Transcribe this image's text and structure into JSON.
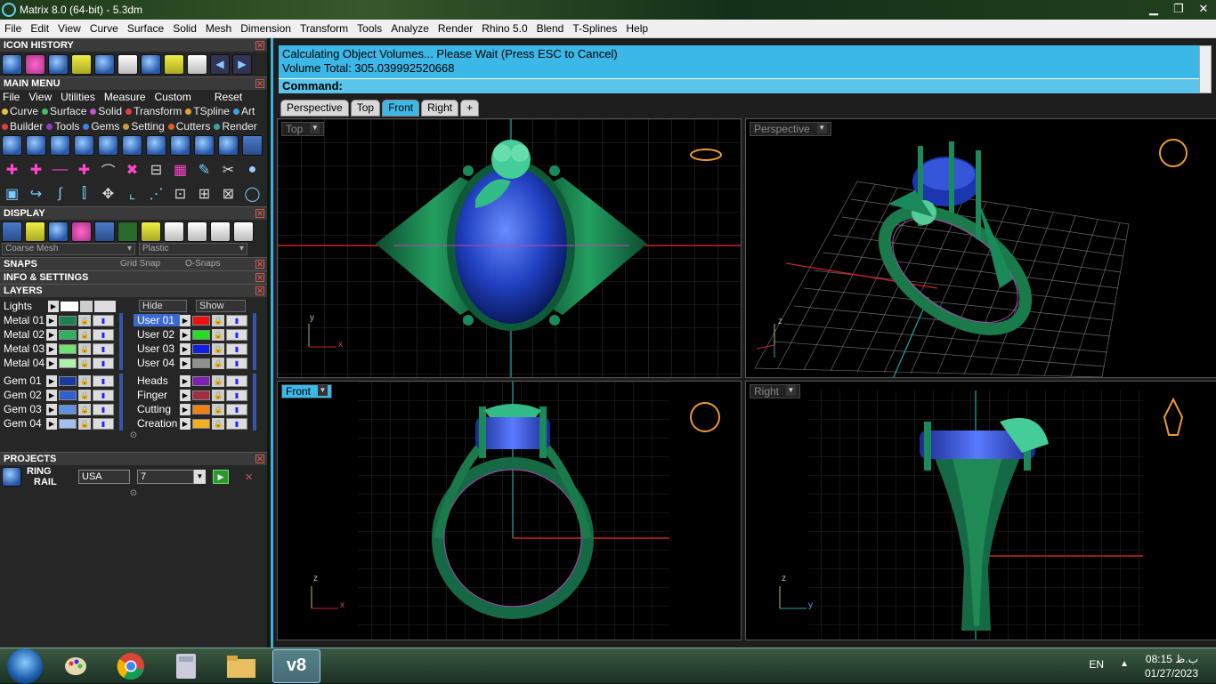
{
  "window": {
    "title": "Matrix 8.0 (64-bit) - 5.3dm"
  },
  "menu": [
    "File",
    "Edit",
    "View",
    "Curve",
    "Surface",
    "Solid",
    "Mesh",
    "Dimension",
    "Transform",
    "Tools",
    "Analyze",
    "Render",
    "Rhino 5.0",
    "Blend",
    "T-Splines",
    "Help"
  ],
  "left": {
    "icon_history": "ICON HISTORY",
    "main_menu": "MAIN MENU",
    "mm_sub": [
      "File",
      "View",
      "Utilities",
      "Measure",
      "Custom",
      "Reset"
    ],
    "cat_row1": [
      {
        "label": "Curve",
        "color": "#e8c040"
      },
      {
        "label": "Surface",
        "color": "#40c060"
      },
      {
        "label": "Solid",
        "color": "#c050d0"
      },
      {
        "label": "Transform",
        "color": "#e04040"
      },
      {
        "label": "TSpline",
        "color": "#e0a030"
      },
      {
        "label": "Art",
        "color": "#40a0e0"
      }
    ],
    "cat_row2": [
      {
        "label": "Builder",
        "color": "#e04040"
      },
      {
        "label": "Tools",
        "color": "#9040c0"
      },
      {
        "label": "Gems",
        "color": "#4080e0"
      },
      {
        "label": "Setting",
        "color": "#c0a040"
      },
      {
        "label": "Cutters",
        "color": "#e06020"
      },
      {
        "label": "Render",
        "color": "#40a0a0"
      }
    ],
    "display": "DISPLAY",
    "mesh_select": "Coarse Mesh",
    "material_select": "Plastic",
    "snaps": "SNAPS",
    "grid_snap": "Grid Snap",
    "osnaps": "O-Snaps",
    "info": "INFO & SETTINGS",
    "layers": "LAYERS",
    "lights": "Lights",
    "hide": "Hide",
    "show": "Show",
    "layers_left": [
      {
        "name": "Metal 01",
        "color": "#1a8050"
      },
      {
        "name": "Metal 02",
        "color": "#30b060"
      },
      {
        "name": "Metal 03",
        "color": "#70e070"
      },
      {
        "name": "Metal 04",
        "color": "#b0f0b0"
      },
      {
        "name": "Gem 01",
        "color": "#1a3aa0"
      },
      {
        "name": "Gem 02",
        "color": "#3060d0"
      },
      {
        "name": "Gem 03",
        "color": "#6090e0"
      },
      {
        "name": "Gem 04",
        "color": "#a0c0f0"
      }
    ],
    "layers_right": [
      {
        "name": "User 01",
        "color": "#ee1010"
      },
      {
        "name": "User 02",
        "color": "#20e020"
      },
      {
        "name": "User 03",
        "color": "#1020e0"
      },
      {
        "name": "User 04",
        "color": "#909090"
      },
      {
        "name": "Heads",
        "color": "#8020b0"
      },
      {
        "name": "Finger",
        "color": "#a03040"
      },
      {
        "name": "Cutting",
        "color": "#f08010"
      },
      {
        "name": "Creation",
        "color": "#f0b020"
      }
    ],
    "projects": "PROJECTS",
    "proj_name1": "RING",
    "proj_name2": "RAIL",
    "proj_country": "USA",
    "proj_size": "7"
  },
  "command": {
    "line1": "Calculating Object Volumes... Please Wait (Press ESC to Cancel)",
    "line2": "Volume Total: 305.039992520668",
    "prompt": "Command:"
  },
  "tabs": [
    "Perspective",
    "Top",
    "Front",
    "Right",
    "+"
  ],
  "active_tab": "Front",
  "viewports": {
    "top": "Top",
    "perspective": "Perspective",
    "front": "Front",
    "right": "Right"
  },
  "axes": {
    "x": "x",
    "y": "y",
    "z": "z"
  },
  "taskbar": {
    "lang": "EN",
    "time": "08:15 ب.ظ",
    "date": "01/27/2023"
  }
}
